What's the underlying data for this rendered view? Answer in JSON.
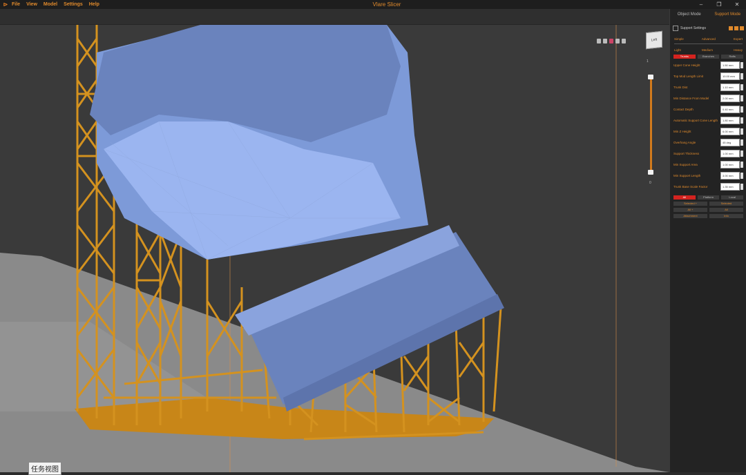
{
  "app": {
    "title": "Vlare Slicer",
    "menu": [
      "File",
      "View",
      "Model",
      "Settings",
      "Help"
    ],
    "window_controls": [
      "–",
      "❐",
      "✕"
    ]
  },
  "viewport": {
    "nav_cube_label": "Left",
    "layer_top": "1",
    "layer_bottom": "0",
    "status_label": "任务视图"
  },
  "panel": {
    "tabs": [
      "Object Mode",
      "Support Mode"
    ],
    "section_title": "Support Settings",
    "density_labels": [
      "Simple",
      "Advanced",
      "Expert"
    ],
    "size_labels": [
      "Light",
      "Medium",
      "Heavy"
    ],
    "type_buttons": [
      "Trunks",
      "Branches",
      "Rafts"
    ],
    "fields": [
      {
        "label": "Upper Cone Height",
        "value": "1.50 mm"
      },
      {
        "label": "Top Mod Length Limit",
        "value": "10.00 mm"
      },
      {
        "label": "Trunk Dist",
        "value": "1.10 mm"
      },
      {
        "label": "Min Distance From Model",
        "value": "2.00 mm"
      },
      {
        "label": "Contact Depth",
        "value": "0.40 mm"
      },
      {
        "label": "Automatic Support Cone Length",
        "value": "1.80 mm"
      },
      {
        "label": "Min Z Height",
        "value": "6.00 mm"
      },
      {
        "label": "Overhang Angle",
        "value": "45 deg"
      },
      {
        "label": "Support Thickness",
        "value": "1.00 mm"
      },
      {
        "label": "Min Support Area",
        "value": "1.00 mm"
      },
      {
        "label": "Min Support Length",
        "value": "3.00 mm"
      },
      {
        "label": "Trunk Base Scale Factor",
        "value": "1.35 mm"
      }
    ],
    "action_buttons": [
      "All",
      "Platform",
      "Local"
    ],
    "grid_buttons": [
      "Selected +",
      "Selected",
      "All +",
      "All",
      "Attachment",
      "Info"
    ]
  },
  "colors": {
    "accent": "#e08a2c",
    "model": "#6f8fcf",
    "support": "#d4921f",
    "active_button": "#d4231f"
  }
}
